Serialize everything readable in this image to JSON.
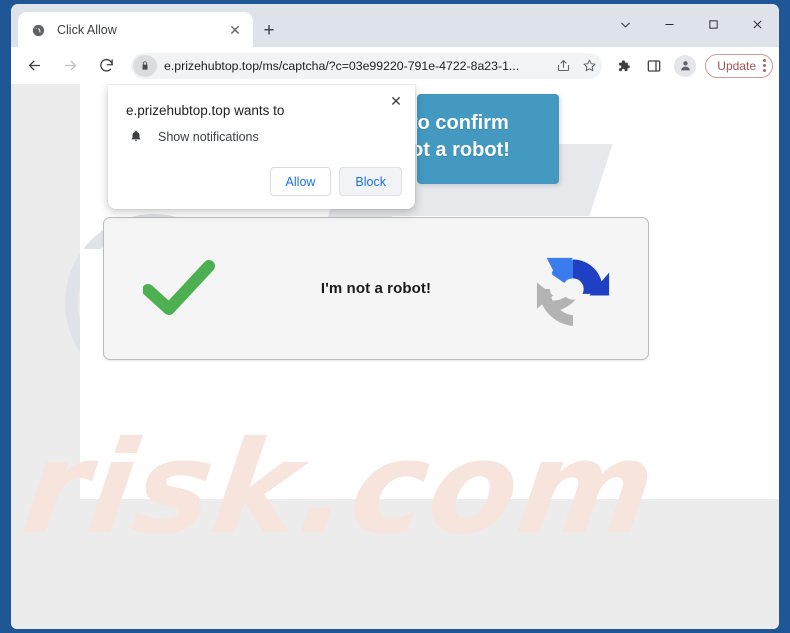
{
  "window": {
    "controls": [
      "chevron-down",
      "minimize",
      "maximize",
      "close"
    ]
  },
  "tabs": [
    {
      "title": "Click Allow",
      "favicon": "globe-icon",
      "close_label": "✕"
    }
  ],
  "newtab": {
    "label": "+"
  },
  "toolbar": {
    "back_label": "←",
    "forward_label": "→",
    "reload_label": "↻",
    "url": "e.prizehubtop.top/ms/captcha/?c=03e99220-791e-4722-8a23-1...",
    "lock_icon": "lock-icon",
    "share_icon": "share-icon",
    "bookmark_icon": "star-icon",
    "extensions_icon": "puzzle-icon",
    "sidepanel_icon": "side-panel-icon",
    "profile_icon": "avatar-icon",
    "update_label": "Update",
    "update_color": "#a0544f",
    "menu_icon": "three-dot-menu-icon"
  },
  "permission_popup": {
    "title": "e.prizehubtop.top wants to",
    "permission": "Show notifications",
    "permission_icon": "bell-icon",
    "close_label": "✕",
    "allow_label": "Allow",
    "block_label": "Block",
    "focused_button": "Block",
    "link_color": "#1a73e8"
  },
  "page": {
    "banner": {
      "line1": "to confirm",
      "line2": "ot a robot!",
      "background": "#4399c0",
      "text_color": "#ffffff"
    },
    "captcha": {
      "check_icon": "green-checkmark-icon",
      "check_color": "#4caf50",
      "text": "I'm not a robot!",
      "logo_icon": "recaptcha-arrows-icon",
      "logo_colors": [
        "#3a7bed",
        "#1f3fc4",
        "#b3b3b3"
      ],
      "background": "#f5f5f5",
      "border_color": "#bdbdbd"
    },
    "watermark": {
      "text": "risk.com",
      "icon": "magnifier-icon",
      "color": "#f7e4dc"
    }
  }
}
